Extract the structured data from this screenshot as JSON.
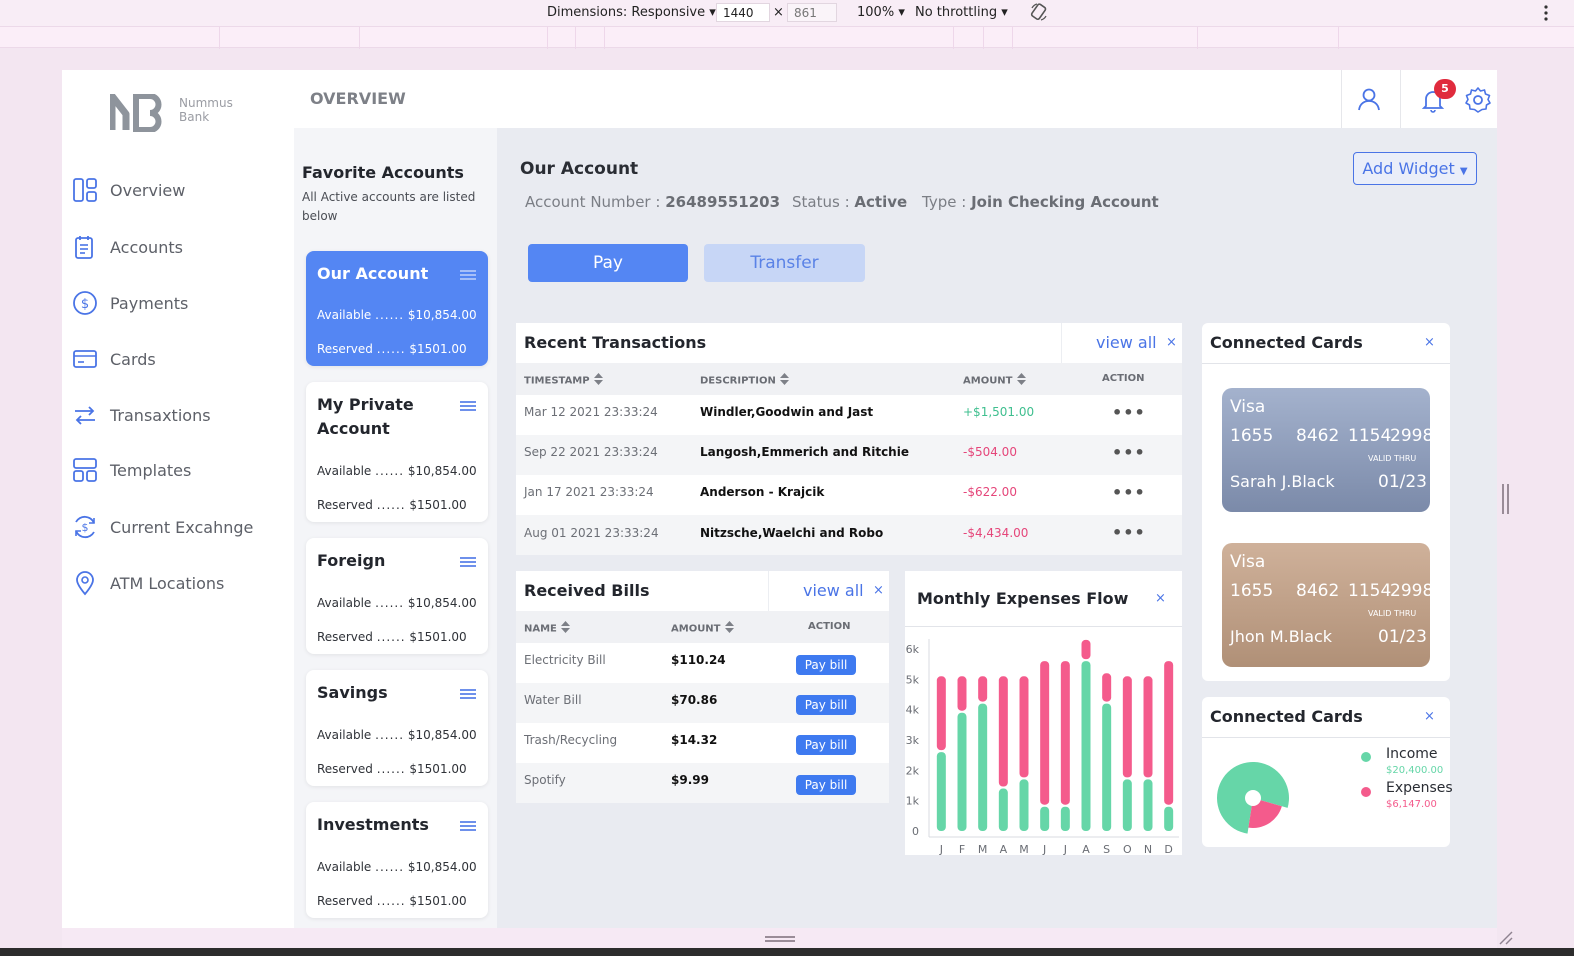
{
  "devtools": {
    "dimensions_label": "Dimensions: Responsive",
    "width": "1440",
    "height": "861",
    "x_sep": "×",
    "zoom": "100%",
    "throttling": "No throttling"
  },
  "brand": {
    "line1": "Nummus",
    "line2": "Bank"
  },
  "header": {
    "title": "OVERVIEW",
    "notification_count": "5"
  },
  "nav": [
    {
      "label": "Overview",
      "icon": "overview-icon"
    },
    {
      "label": "Accounts",
      "icon": "accounts-icon"
    },
    {
      "label": "Payments",
      "icon": "payments-icon"
    },
    {
      "label": "Cards",
      "icon": "cards-icon"
    },
    {
      "label": "Transaxtions",
      "icon": "transactions-icon"
    },
    {
      "label": "Templates",
      "icon": "templates-icon"
    },
    {
      "label": "Current Excahnge",
      "icon": "exchange-icon"
    },
    {
      "label": "ATM Locations",
      "icon": "location-icon"
    }
  ],
  "favorites": {
    "title": "Favorite Accounts",
    "subtitle_line1": "All Active accounts are listed",
    "subtitle_line2": "below",
    "accounts": [
      {
        "name_line1": "Our Account",
        "name_line2": "",
        "available_label": "Available",
        "available": "$10,854.00",
        "reserved_label": "Reserved",
        "reserved": "$1501.00",
        "dots": "......"
      },
      {
        "name_line1": "My Private",
        "name_line2": "Account",
        "available_label": "Available",
        "available": "$10,854.00",
        "reserved_label": "Reserved",
        "reserved": "$1501.00",
        "dots": "......"
      },
      {
        "name_line1": "Foreign",
        "name_line2": "",
        "available_label": "Available",
        "available": "$10,854.00",
        "reserved_label": "Reserved",
        "reserved": "$1501.00",
        "dots": "......"
      },
      {
        "name_line1": "Savings",
        "name_line2": "",
        "available_label": "Available",
        "available": "$10,854.00",
        "reserved_label": "Reserved",
        "reserved": "$1501.00",
        "dots": "......"
      },
      {
        "name_line1": "Investments",
        "name_line2": "",
        "available_label": "Available",
        "available": "$10,854.00",
        "reserved_label": "Reserved",
        "reserved": "$1501.00",
        "dots": "......"
      }
    ]
  },
  "account": {
    "title": "Our Account",
    "number_label": "Account Number :",
    "number": "26489551203",
    "status_label": "Status :",
    "status": "Active",
    "type_label": "Type :",
    "type": "Join Checking Account",
    "pay_label": "Pay",
    "transfer_label": "Transfer",
    "add_widget_label": "Add Widget"
  },
  "transactions": {
    "title": "Recent Transactions",
    "view_all": "view all",
    "close": "×",
    "columns": [
      "TIMESTAMP",
      "DESCRIPTION",
      "AMOUNT",
      "ACTION"
    ],
    "rows": [
      {
        "timestamp": "Mar 12 2021 23:33:24",
        "description": "Windler,Goodwin and Jast",
        "amount": "+$1,501.00",
        "sign": "pos"
      },
      {
        "timestamp": "Sep 22 2021 23:33:24",
        "description": "Langosh,Emmerich and Ritchie",
        "amount": "-$504.00",
        "sign": "neg"
      },
      {
        "timestamp": "Jan 17 2021 23:33:24",
        "description": "Anderson - Krajcik",
        "amount": "-$622.00",
        "sign": "neg"
      },
      {
        "timestamp": "Aug 01 2021 23:33:24",
        "description": "Nitzsche,Waelchi and Robo",
        "amount": "-$4,434.00",
        "sign": "neg"
      }
    ],
    "action_glyph": "•••"
  },
  "bills": {
    "title": "Received Bills",
    "view_all": "view all",
    "close": "×",
    "columns": [
      "NAME",
      "AMOUNT",
      "ACTION"
    ],
    "pay_label": "Pay bill",
    "rows": [
      {
        "name": "Electricity Bill",
        "amount": "$110.24"
      },
      {
        "name": "Water Bill",
        "amount": "$70.86"
      },
      {
        "name": "Trash/Recycling",
        "amount": "$14.32"
      },
      {
        "name": "Spotify",
        "amount": "$9.99"
      }
    ]
  },
  "expenses_chart": {
    "title": "Monthly Expenses Flow",
    "close": "×"
  },
  "chart_data": {
    "type": "bar",
    "categories": [
      "J",
      "F",
      "M",
      "A",
      "M",
      "J",
      "J",
      "A",
      "S",
      "O",
      "N",
      "D"
    ],
    "yticks": [
      "0",
      "1k",
      "2k",
      "3k",
      "4k",
      "5k",
      "6k"
    ],
    "ylim": [
      0,
      6000
    ],
    "stacked": true,
    "series": [
      {
        "color": "#66d6a8",
        "values": [
          2600,
          3900,
          4200,
          1400,
          1700,
          800,
          800,
          5600,
          4200,
          1700,
          1700,
          800
        ]
      },
      {
        "color": "#f45b8c",
        "values": [
          2500,
          1200,
          900,
          3700,
          3400,
          4800,
          4800,
          700,
          1000,
          3400,
          3400,
          4800
        ]
      }
    ]
  },
  "connected_cards": {
    "title": "Connected Cards",
    "close": "×",
    "cards": [
      {
        "brand": "Visa",
        "numbers": [
          "1655",
          "8462",
          "1154",
          "2998"
        ],
        "valid_label": "VALID THRU",
        "holder": "Sarah J.Black",
        "expiry": "01/23",
        "color_top": "#a4b2cd",
        "color_bottom": "#7b8aa9"
      },
      {
        "brand": "Visa",
        "numbers": [
          "1655",
          "8462",
          "1154",
          "2998"
        ],
        "valid_label": "VALID THRU",
        "holder": "Jhon M.Black",
        "expiry": "01/23",
        "color_top": "#cfb19a",
        "color_bottom": "#b09077"
      }
    ]
  },
  "income_widget": {
    "title": "Connected Cards",
    "close": "×",
    "income_label": "Income",
    "income_value": "$20,400.00",
    "expenses_label": "Expenses",
    "expenses_value": "$6,147.00",
    "income_color": "#66d6a8",
    "expenses_color": "#f45b8c",
    "income_fraction": 0.77
  }
}
